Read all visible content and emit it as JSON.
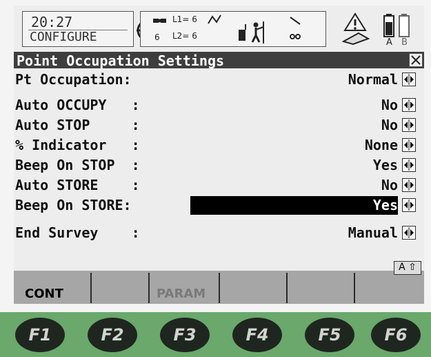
{
  "status_bar": {
    "time": "20:27",
    "mode": "CONFIGURE",
    "satellites_l1": "L1= 6",
    "satellites_l2": "L2= 6",
    "satellites_count": "6",
    "battery_labels": [
      "A",
      "B"
    ]
  },
  "dialog": {
    "title": "Point Occupation Settings",
    "close_glyph": "✕"
  },
  "settings": [
    {
      "label": "Pt Occupation:",
      "value": "Normal",
      "selected": false
    },
    {
      "label": "Auto OCCUPY   :",
      "value": "No",
      "selected": false
    },
    {
      "label": "Auto STOP     :",
      "value": "No",
      "selected": false
    },
    {
      "label": "% Indicator   :",
      "value": "None",
      "selected": false
    },
    {
      "label": "Beep On STOP  :",
      "value": "Yes",
      "selected": false
    },
    {
      "label": "Auto STORE    :",
      "value": "No",
      "selected": false
    },
    {
      "label": "Beep On STORE:",
      "value": "Yes",
      "selected": true
    },
    {
      "label": "End Survey    :",
      "value": "Manual",
      "selected": false
    }
  ],
  "softkeys": {
    "f1": "CONT",
    "f2": "",
    "f3": "PARAM",
    "f4": "",
    "f5": "",
    "f6": "",
    "input_mode": "A ⇧"
  },
  "function_keys": [
    "F1",
    "F2",
    "F3",
    "F4",
    "F5",
    "F6"
  ],
  "colors": {
    "screen_bg": "#ededed",
    "title_bg": "#3e3e3e",
    "highlight": "#000000",
    "softkey_bar": "#a6a6a6",
    "keypad": "#6aa86c"
  }
}
